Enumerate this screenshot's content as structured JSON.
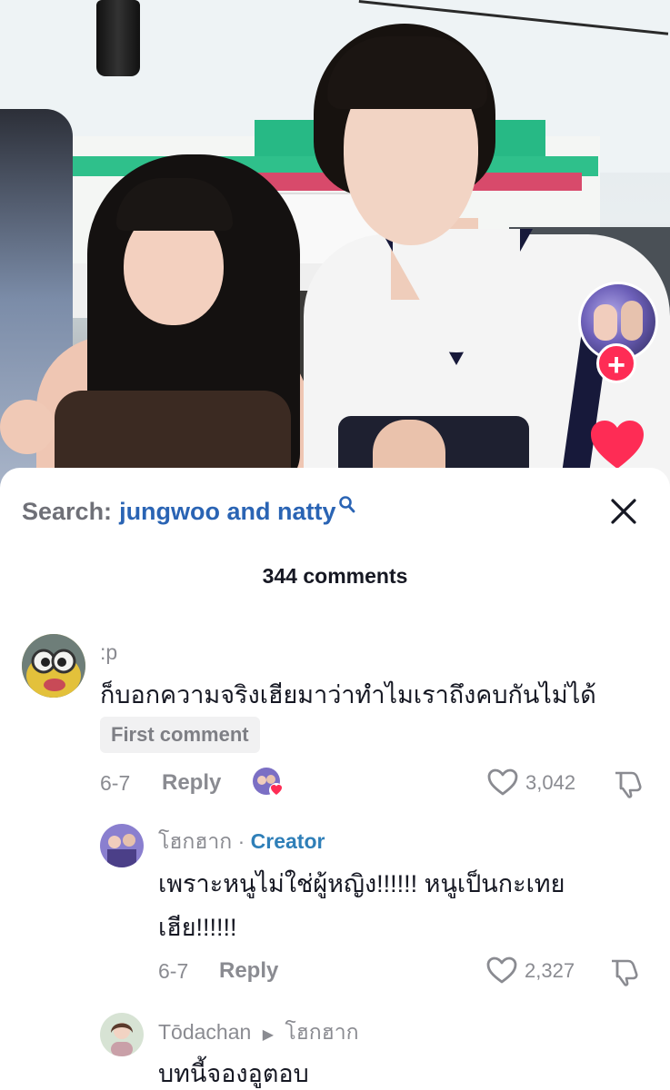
{
  "video": {
    "follow_plus": "+"
  },
  "sheet": {
    "search_label": "Search:",
    "search_query": "jungwoo and natty",
    "comment_count": "344 comments"
  },
  "comments": [
    {
      "username": ":p",
      "text": "ก็บอกความจริงเฮียมาว่าทำไมเราถึงคบกันไม่ได้",
      "badge": "First comment",
      "date": "6-7",
      "reply": "Reply",
      "likes": "3,042"
    },
    {
      "username": "โฮกฮาก",
      "separator": "·",
      "creator_label": "Creator",
      "text_line1": "เพราะหนูไม่ใช่ผู้หญิง!!!!!! หนูเป็นกะเทย",
      "text_line2": "เฮีย!!!!!!",
      "date": "6-7",
      "reply": "Reply",
      "likes": "2,327"
    },
    {
      "username": "Tōdachan",
      "reply_to": "โฮกฮาก",
      "text": "บทนี้จองอูตอบ"
    }
  ],
  "icons": {
    "search": "search-icon",
    "close": "close-icon",
    "heart": "heart-outline-icon",
    "dislike": "thumbs-down-icon",
    "reply_arrow": "triangle-right-icon"
  },
  "colors": {
    "accent_red": "#fe2c55",
    "query_blue": "#2a64b4",
    "creator_blue": "#2f7fb8",
    "muted_gray": "#8a8b91"
  }
}
